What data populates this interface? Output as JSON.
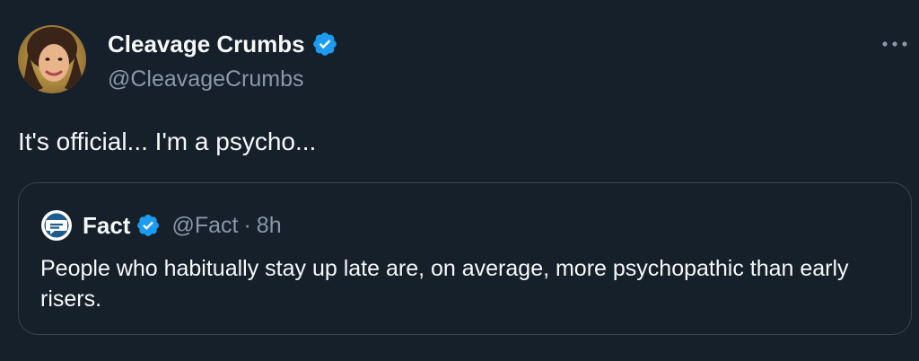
{
  "tweet": {
    "author": {
      "display_name": "Cleavage Crumbs",
      "handle": "@CleavageCrumbs",
      "verified": true,
      "avatar_icon": "profile-photo-avatar"
    },
    "text": "It's official... I'm a psycho...",
    "more_icon": "more-options-icon"
  },
  "quoted_tweet": {
    "author": {
      "display_name": "Fact",
      "handle": "@Fact",
      "verified": true,
      "avatar_icon": "fact-logo-avatar"
    },
    "separator": "·",
    "time": "8h",
    "text": "People who habitually stay up late are, on average, more psychopathic than early risers."
  },
  "colors": {
    "background": "#15202b",
    "border": "#38444d",
    "primary_text": "#f7f9f9",
    "secondary_text": "#8b98a5",
    "verified_blue": "#1d9bf0"
  }
}
